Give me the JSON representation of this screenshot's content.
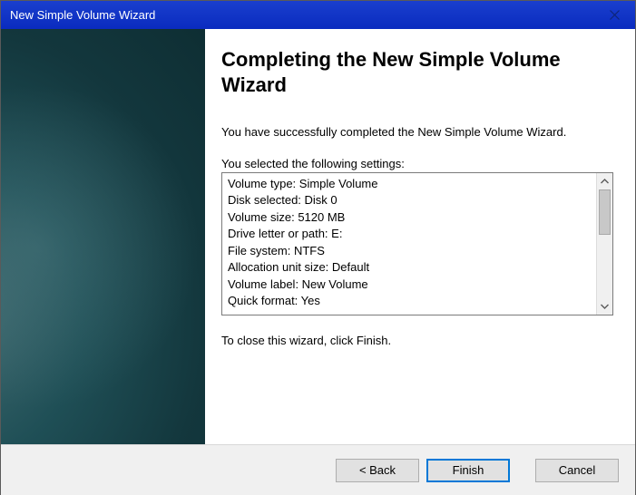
{
  "window": {
    "title": "New Simple Volume Wizard"
  },
  "wizard": {
    "heading": "Completing the New Simple Volume Wizard",
    "success_text": "You have successfully completed the New Simple Volume Wizard.",
    "settings_label": "You selected the following settings:",
    "close_text": "To close this wizard, click Finish."
  },
  "settings": {
    "lines": [
      "Volume type: Simple Volume",
      "Disk selected: Disk 0",
      "Volume size: 5120 MB",
      "Drive letter or path: E:",
      "File system: NTFS",
      "Allocation unit size: Default",
      "Volume label: New Volume",
      "Quick format: Yes"
    ]
  },
  "buttons": {
    "back": "< Back",
    "finish": "Finish",
    "cancel": "Cancel"
  }
}
